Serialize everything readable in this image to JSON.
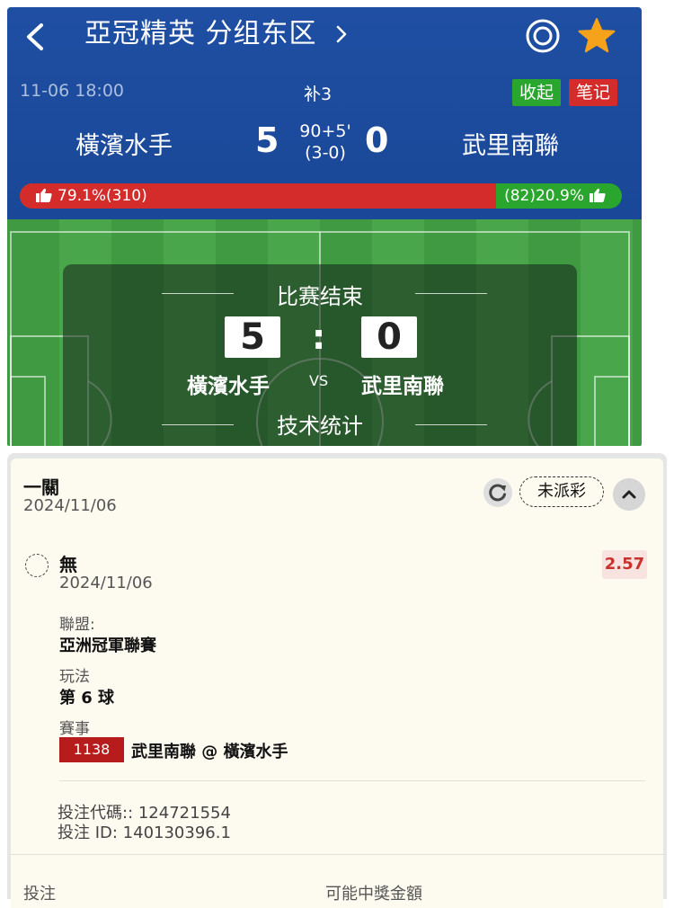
{
  "header": {
    "title": "亞冠精英 分组东区",
    "time": "11-06 18:00",
    "extra_time": "补3",
    "collapse_label": "收起",
    "notes_label": "笔记",
    "home_team": "橫濱水手",
    "away_team": "武里南聯",
    "home_score": "5",
    "away_score": "0",
    "match_minute": "90+5'",
    "half_time_score": "(3-0)",
    "colors": {
      "header_bg": "#1f4fa3",
      "green": "#2aa52d",
      "red": "#d42b2b",
      "star": "#f7a21b"
    }
  },
  "votes": {
    "home_text": "79.1%(310)",
    "away_text": "(82)20.9%",
    "home_fraction": 0.791
  },
  "result": {
    "status": "比赛结束",
    "home_score": "5",
    "separator": ":",
    "away_score": "0",
    "home_team": "橫濱水手",
    "vs": "VS",
    "away_team": "武里南聯",
    "stats_label": "技术统计"
  },
  "bet": {
    "title": "一關",
    "date": "2024/11/06",
    "status": "未派彩",
    "selection": "無",
    "selection_date": "2024/11/06",
    "odds": "2.57",
    "league_label": "聯盟:",
    "league": "亞洲冠軍聯賽",
    "market_label": "玩法",
    "market": "第 6 球",
    "event_label": "賽事",
    "event_id": "1138",
    "event_name": "武里南聯 @ 橫濱水手",
    "bet_code": "投注代碼:: 124721554",
    "bet_id": "投注 ID: 140130396.1",
    "stake_label": "投注",
    "payout_label": "可能中獎金額"
  }
}
